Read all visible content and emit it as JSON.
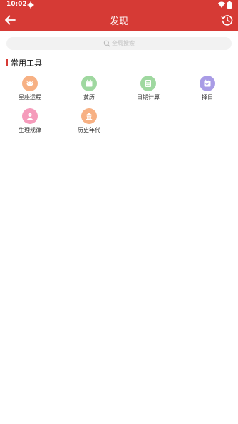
{
  "status_bar": {
    "time": "10:02"
  },
  "header": {
    "title": "发现",
    "background": "#d63a35"
  },
  "search": {
    "placeholder": "全局搜索"
  },
  "section": {
    "title": "常用工具",
    "accent": "#d63a35"
  },
  "tools": [
    {
      "label": "星座运程",
      "icon": "zodiac-icon",
      "color": "#f7b184"
    },
    {
      "label": "黄历",
      "icon": "almanac-icon",
      "color": "#9fd8a0"
    },
    {
      "label": "日期计算",
      "icon": "date-calculator-icon",
      "color": "#9fd8a0"
    },
    {
      "label": "择日",
      "icon": "date-picker-icon",
      "color": "#a99ce6"
    },
    {
      "label": "生理规律",
      "icon": "biorhythm-icon",
      "color": "#f59bbb"
    },
    {
      "label": "历史年代",
      "icon": "history-era-icon",
      "color": "#f7b184"
    }
  ]
}
